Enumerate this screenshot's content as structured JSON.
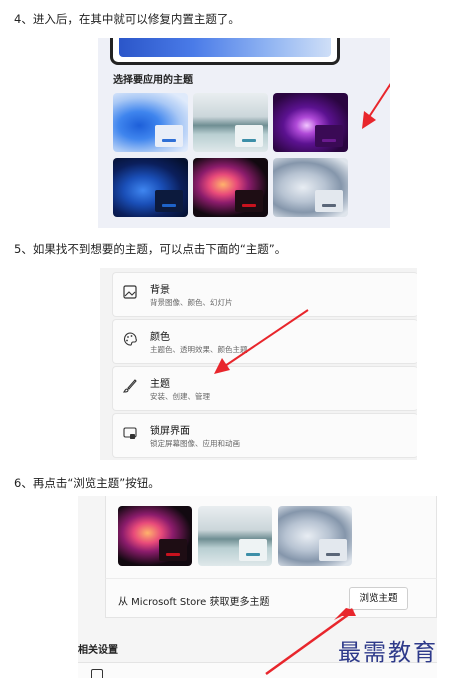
{
  "steps": {
    "step4": "4、进入后，在其中就可以修复内置主题了。",
    "step5": "5、如果找不到想要的主题，可以点击下面的“主题”。",
    "step6": "6、再点击“浏览主题”按钮。"
  },
  "panel1": {
    "heading": "选择要应用的主题",
    "themes": [
      {
        "name": "bloom-blue-light",
        "accent": "#2f6fd6"
      },
      {
        "name": "lake-dawn",
        "accent": "#3d8fa8"
      },
      {
        "name": "glow-purple",
        "accent": "#6a1a8f"
      },
      {
        "name": "bloom-blue-dark",
        "accent": "#1e63c9"
      },
      {
        "name": "captured-motion",
        "accent": "#c8121e"
      },
      {
        "name": "flow-gray",
        "accent": "#5a6678"
      }
    ]
  },
  "panel2": {
    "rows": [
      {
        "icon": "image-icon",
        "title": "背景",
        "subtitle": "背景图像、颜色、幻灯片"
      },
      {
        "icon": "palette-icon",
        "title": "颜色",
        "subtitle": "主题色、透明效果、颜色主题"
      },
      {
        "icon": "brush-icon",
        "title": "主题",
        "subtitle": "安装、创建、管理"
      },
      {
        "icon": "lock-screen-icon",
        "title": "锁屏界面",
        "subtitle": "锁定屏幕图像、应用和动画"
      }
    ]
  },
  "panel3": {
    "store_text": "从 Microsoft Store 获取更多主题",
    "browse_button": "浏览主题",
    "related_heading": "相关设置"
  },
  "watermark": "最需教育",
  "colors": {
    "arrow": "#e8262c",
    "panel_bg": "#eef0f7",
    "watermark": "#2e3a8a"
  }
}
